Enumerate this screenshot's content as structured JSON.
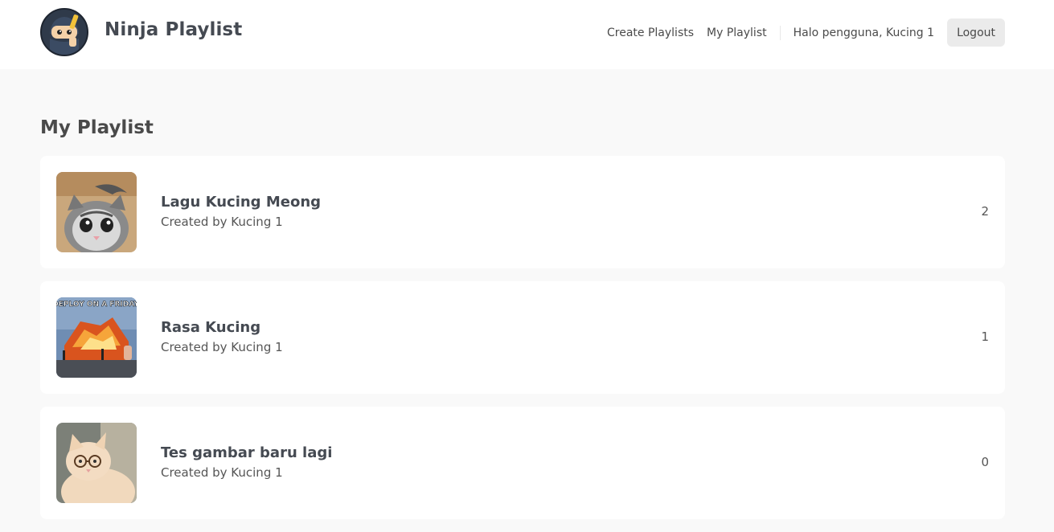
{
  "brand": {
    "name": "Ninja Playlist",
    "logo_icon": "ninja-mascot-icon"
  },
  "nav": {
    "create_playlists": "Create Playlists",
    "my_playlist": "My Playlist",
    "greeting": "Halo pengguna, Kucing 1",
    "logout": "Logout"
  },
  "page": {
    "title": "My Playlist"
  },
  "playlists": [
    {
      "title": "Lagu Kucing Meong",
      "subtitle": "Created by Kucing 1",
      "count": "2",
      "thumbnail": "cat-photo-thumbnail"
    },
    {
      "title": "Rasa Kucing",
      "subtitle": "Created by Kucing 1",
      "count": "1",
      "thumbnail": "deploy-on-friday-meme-thumbnail",
      "thumbnail_caption": "DEPLOY ON A FRIDAY."
    },
    {
      "title": "Tes gambar baru lagi",
      "subtitle": "Created by Kucing 1",
      "count": "0",
      "thumbnail": "cat-with-glasses-thumbnail"
    }
  ],
  "colors": {
    "background": "#f9f9f9",
    "card": "#ffffff",
    "text": "#4a4a4a",
    "button": "#ebebeb"
  }
}
